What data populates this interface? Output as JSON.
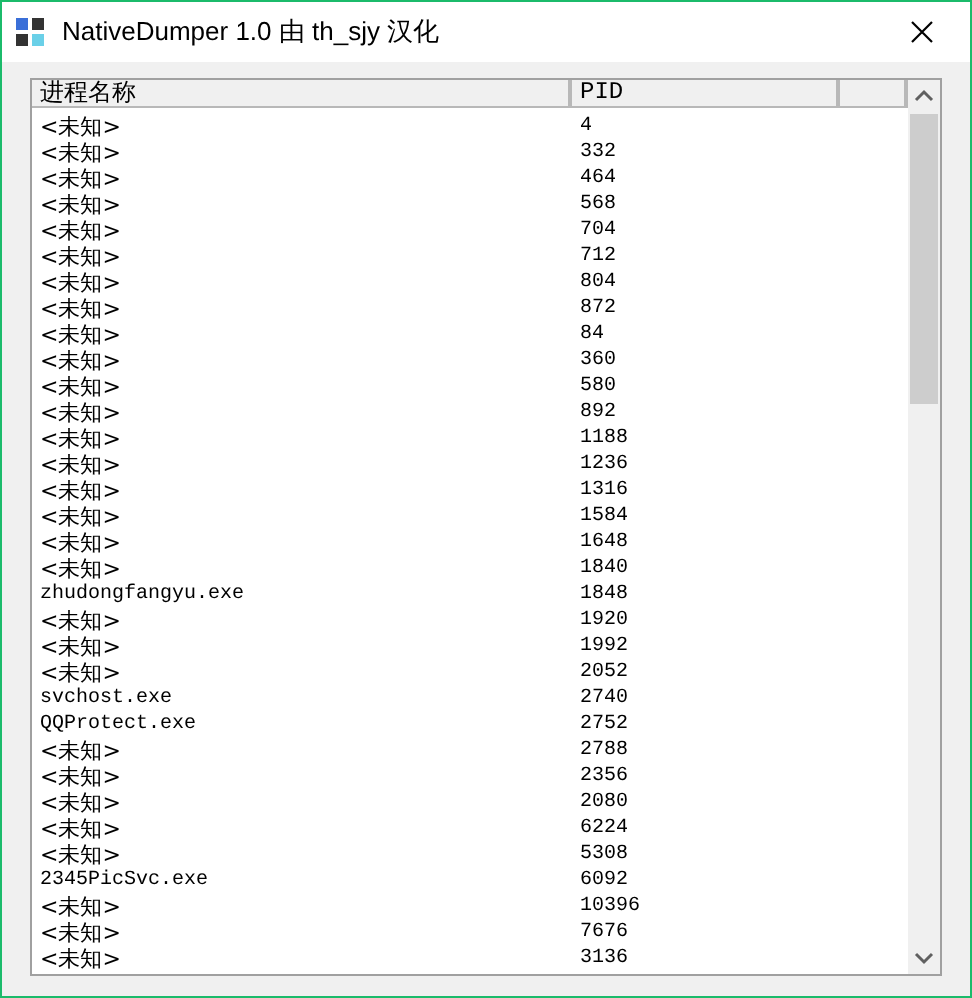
{
  "window": {
    "title": "NativeDumper 1.0 由 th_sjy 汉化"
  },
  "table": {
    "columns": [
      "进程名称",
      "PID"
    ],
    "rows": [
      [
        "<未知>",
        "4"
      ],
      [
        "<未知>",
        "332"
      ],
      [
        "<未知>",
        "464"
      ],
      [
        "<未知>",
        "568"
      ],
      [
        "<未知>",
        "704"
      ],
      [
        "<未知>",
        "712"
      ],
      [
        "<未知>",
        "804"
      ],
      [
        "<未知>",
        "872"
      ],
      [
        "<未知>",
        "84"
      ],
      [
        "<未知>",
        "360"
      ],
      [
        "<未知>",
        "580"
      ],
      [
        "<未知>",
        "892"
      ],
      [
        "<未知>",
        "1188"
      ],
      [
        "<未知>",
        "1236"
      ],
      [
        "<未知>",
        "1316"
      ],
      [
        "<未知>",
        "1584"
      ],
      [
        "<未知>",
        "1648"
      ],
      [
        "<未知>",
        "1840"
      ],
      [
        "zhudongfangyu.exe",
        "1848"
      ],
      [
        "<未知>",
        "1920"
      ],
      [
        "<未知>",
        "1992"
      ],
      [
        "<未知>",
        "2052"
      ],
      [
        "svchost.exe",
        "2740"
      ],
      [
        "QQProtect.exe",
        "2752"
      ],
      [
        "<未知>",
        "2788"
      ],
      [
        "<未知>",
        "2356"
      ],
      [
        "<未知>",
        "2080"
      ],
      [
        "<未知>",
        "6224"
      ],
      [
        "<未知>",
        "5308"
      ],
      [
        "2345PicSvc.exe",
        "6092"
      ],
      [
        "<未知>",
        "10396"
      ],
      [
        "<未知>",
        "7676"
      ],
      [
        "<未知>",
        "3136"
      ]
    ]
  }
}
